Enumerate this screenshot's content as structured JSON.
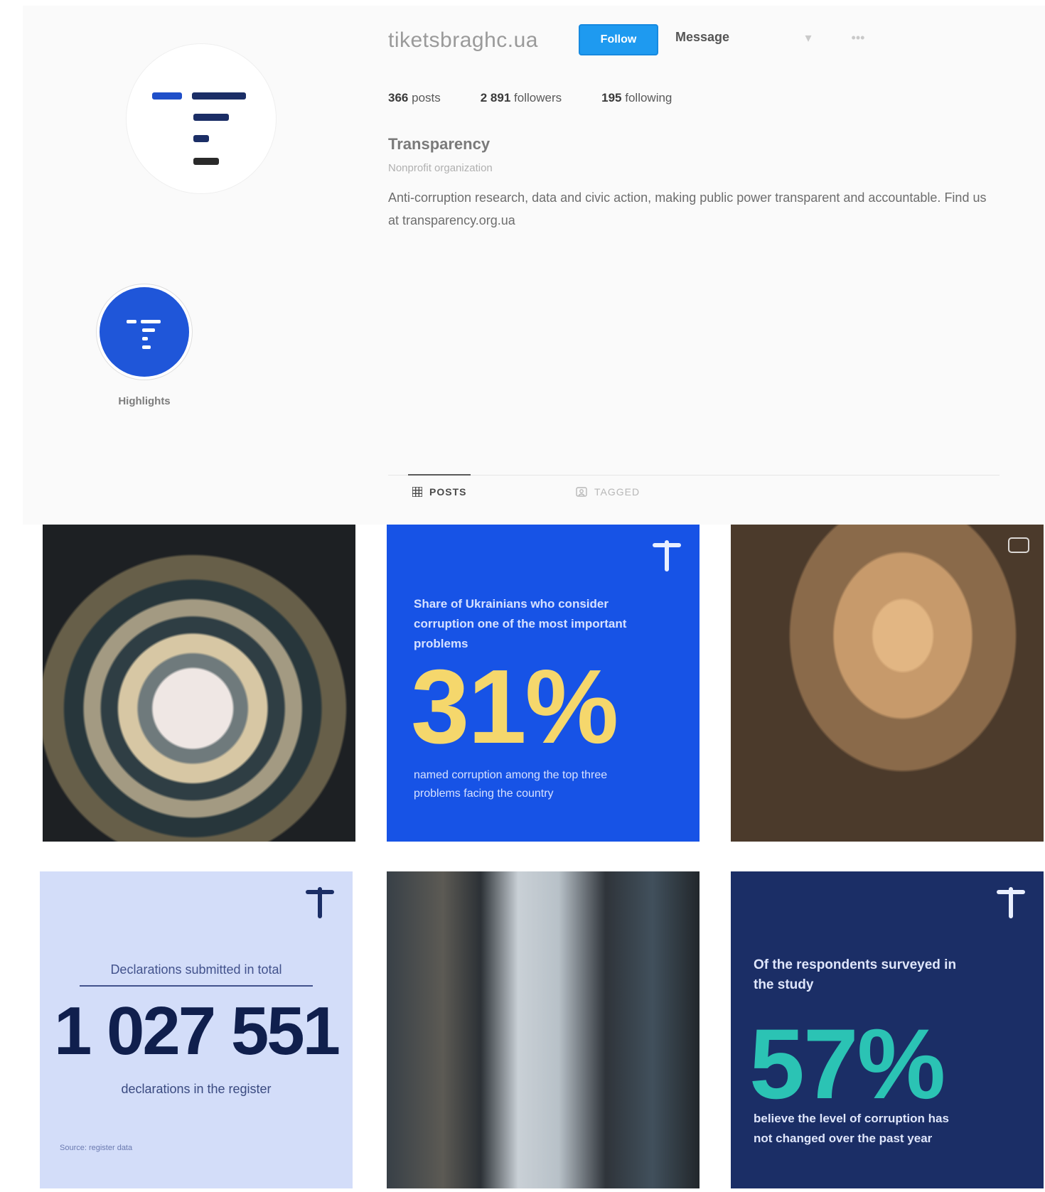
{
  "profile": {
    "username": "tiketsbraghc.ua",
    "follow_label": "Follow",
    "contact_label": "Message",
    "more_icon": "more-icon",
    "stats": {
      "posts": {
        "count": "366",
        "label": "posts"
      },
      "followers": {
        "count": "2 891",
        "label": "followers"
      },
      "following": {
        "count": "195",
        "label": "following"
      }
    },
    "bio": {
      "name": "Transparency",
      "category": "Nonprofit organization",
      "text": "Anti-corruption research, data and civic action, making public power transparent and accountable. Find us at transparency.org.ua"
    }
  },
  "highlights": [
    {
      "label": "Highlights",
      "icon": "logo-icon"
    }
  ],
  "tabs": [
    {
      "label": "POSTS",
      "icon": "grid-icon",
      "active": true
    },
    {
      "label": "TAGGED",
      "icon": "tag-icon",
      "active": false
    }
  ],
  "posts": [
    {
      "type": "photo",
      "description": "spiral-photo"
    },
    {
      "type": "stat",
      "headline": "Share of Ukrainians who consider corruption one of the most important problems",
      "value": "31%",
      "footnote": "named corruption among the top three problems facing the country"
    },
    {
      "type": "photo",
      "description": "portrait-photo"
    },
    {
      "type": "stat",
      "headline": "Declarations submitted in total",
      "value": "1 027 551",
      "subtitle": "declarations in the register",
      "source": "Source: register data"
    },
    {
      "type": "photo",
      "description": "group-photo"
    },
    {
      "type": "stat",
      "headline": "Of the respondents surveyed in the study",
      "value": "57%",
      "footnote": "believe the level of corruption has not changed over the past year"
    }
  ],
  "colors": {
    "accent": "#1e9af0",
    "brand_blue": "#1753e6",
    "brand_navy": "#1b2e66",
    "highlight_yellow": "#f5d76c",
    "teal": "#2bc3b4"
  }
}
